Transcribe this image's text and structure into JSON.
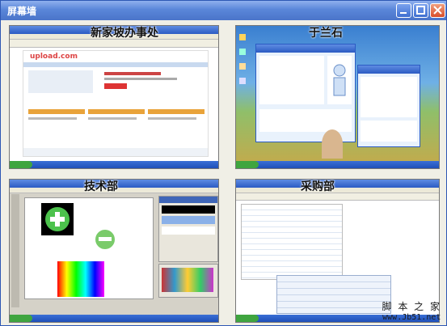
{
  "window": {
    "title": "屏幕墙",
    "controls": [
      "minimize-icon",
      "maximize-icon",
      "close-icon"
    ]
  },
  "panes": [
    {
      "label": "新家坡办事处",
      "content": "browser-screen",
      "page_heading": "upload.com"
    },
    {
      "label": "于兰石",
      "content": "chat-desktop-screen"
    },
    {
      "label": "技术部",
      "content": "image-editor-screen"
    },
    {
      "label": "采购部",
      "content": "spreadsheet-screen"
    }
  ],
  "watermark": {
    "line1": "脚 本 之 家",
    "line2": "www.Jb51.net"
  },
  "colors": {
    "titlebar": "#4a74c9",
    "accent": "#2b5bc3",
    "green_button": "#3fa53f"
  }
}
